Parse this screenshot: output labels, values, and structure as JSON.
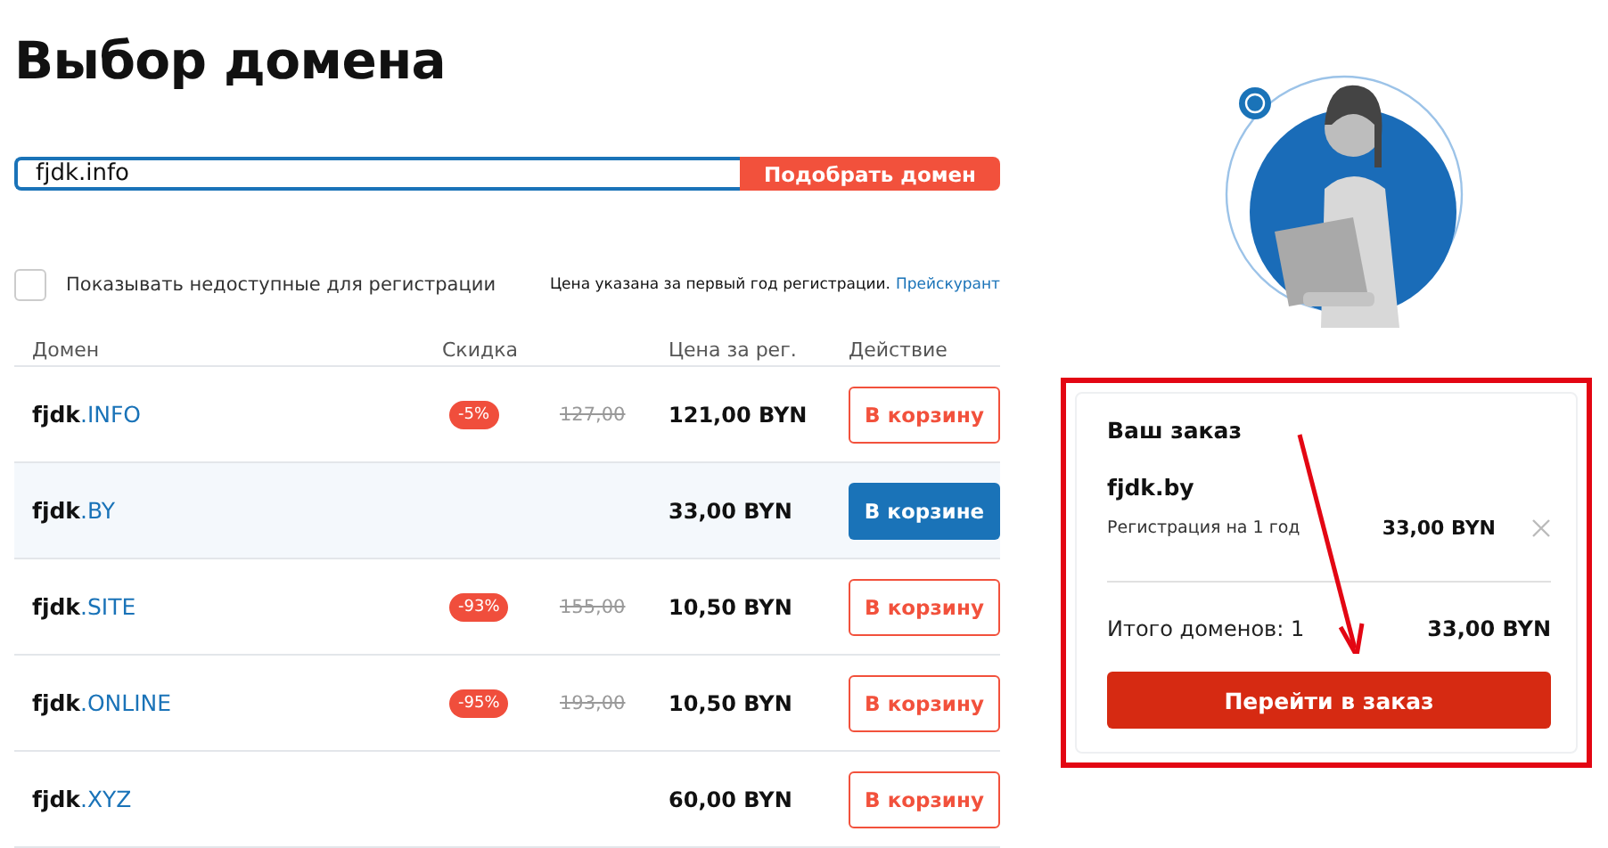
{
  "title": "Выбор домена",
  "search": {
    "value": "fjdk.info",
    "button": "Подобрать домен"
  },
  "show_unavailable": {
    "label": "Показывать недоступные для регистрации",
    "checked": false
  },
  "price_note": {
    "text": "Цена указана за первый год регистрации.",
    "link": "Прейскурант"
  },
  "table": {
    "columns": [
      "Домен",
      "Скидка",
      "",
      "Цена за рег.",
      "Действие"
    ],
    "rows": [
      {
        "name": "fjdk",
        "zone": ".INFO",
        "discount": "-5%",
        "old_price": "127,00",
        "price": "121,00 BYN",
        "action": "В корзину",
        "in_cart": false
      },
      {
        "name": "fjdk",
        "zone": ".BY",
        "price": "33,00 BYN",
        "action": "В корзине",
        "in_cart": true
      },
      {
        "name": "fjdk",
        "zone": ".SITE",
        "discount": "-93%",
        "old_price": "155,00",
        "price": "10,50 BYN",
        "action": "В корзину",
        "in_cart": false
      },
      {
        "name": "fjdk",
        "zone": ".ONLINE",
        "discount": "-95%",
        "old_price": "193,00",
        "price": "10,50 BYN",
        "action": "В корзину",
        "in_cart": false
      },
      {
        "name": "fjdk",
        "zone": ".XYZ",
        "price": "60,00 BYN",
        "action": "В корзину",
        "in_cart": false
      }
    ]
  },
  "order": {
    "title": "Ваш заказ",
    "items": [
      {
        "domain": "fjdk.by",
        "term": "Регистрация на 1 год",
        "price": "33,00 BYN"
      }
    ],
    "total_label": "Итого доменов: 1",
    "total": "33,00 BYN",
    "button": "Перейти в заказ"
  }
}
